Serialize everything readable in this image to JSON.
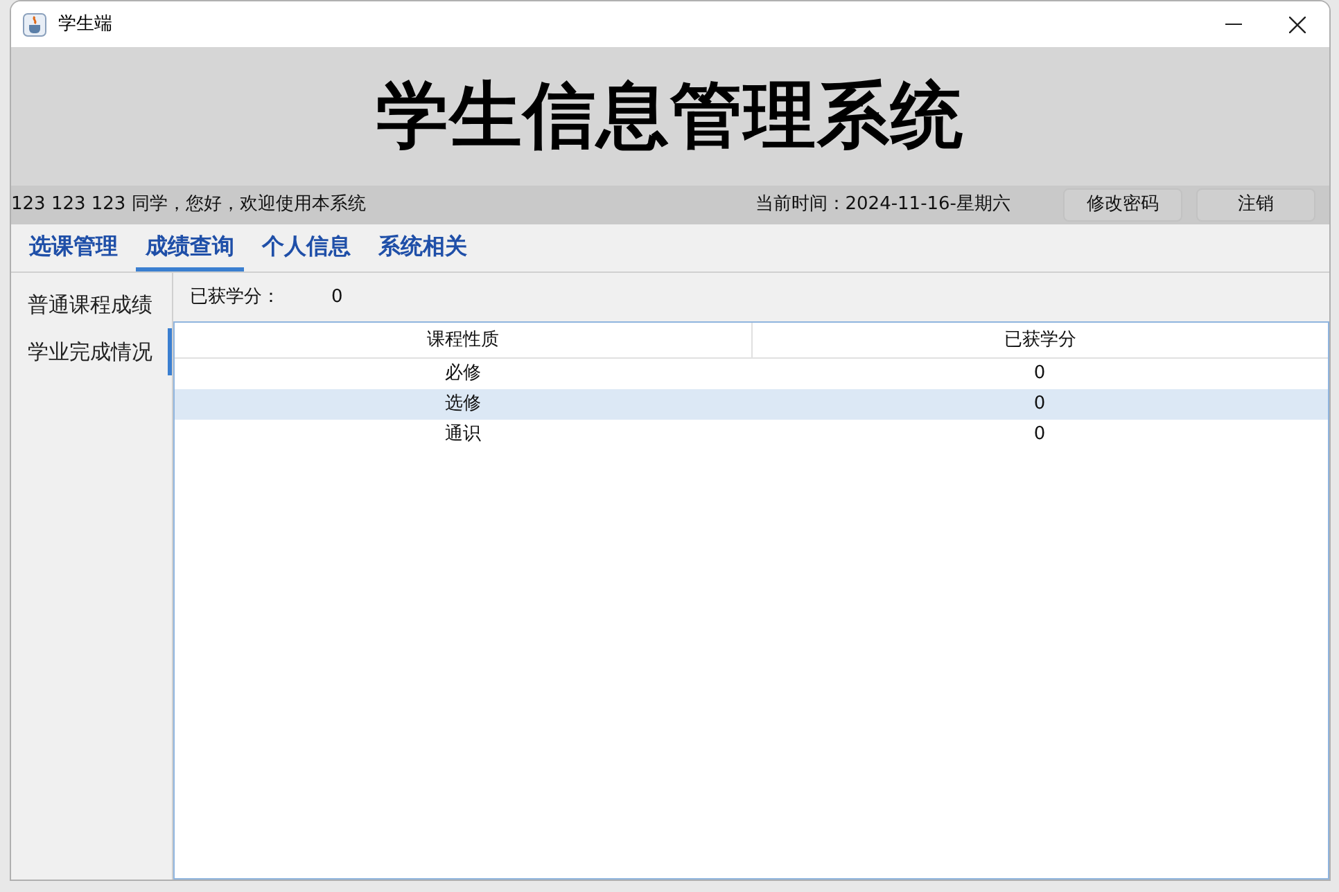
{
  "window": {
    "title": "学生端"
  },
  "banner": {
    "title": "学生信息管理系统"
  },
  "info_bar": {
    "greeting": "123 123 123 同学，您好，欢迎使用本系统",
    "time": "当前时间：2024-11-16-星期六",
    "buttons": [
      "修改密码",
      "注销"
    ]
  },
  "tabs": [
    {
      "label": "选课管理",
      "selected": false
    },
    {
      "label": "成绩查询",
      "selected": true
    },
    {
      "label": "个人信息",
      "selected": false
    },
    {
      "label": "系统相关",
      "selected": false
    }
  ],
  "sidebar": {
    "items": [
      {
        "label": "普通课程成绩",
        "selected": false
      },
      {
        "label": "学业完成情况",
        "selected": true
      }
    ]
  },
  "summary": {
    "label": "已获学分：",
    "value": "0"
  },
  "table": {
    "columns": [
      "课程性质",
      "已获学分"
    ],
    "rows": [
      {
        "cells": [
          "必修",
          "0"
        ],
        "selected": false
      },
      {
        "cells": [
          "选修",
          "0"
        ],
        "selected": true
      },
      {
        "cells": [
          "通识",
          "0"
        ],
        "selected": false
      }
    ]
  }
}
